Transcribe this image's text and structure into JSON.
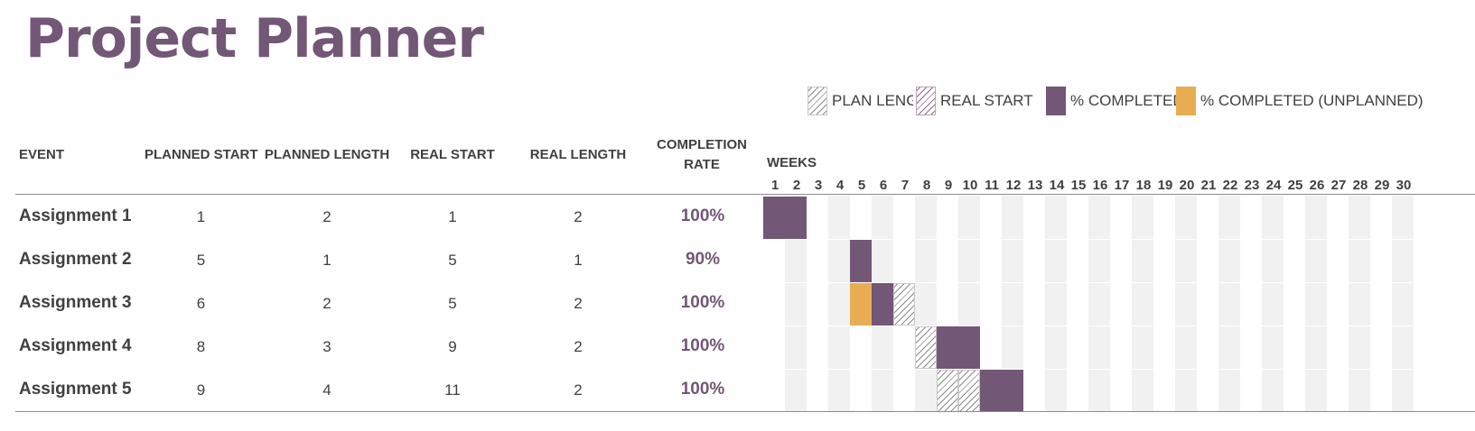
{
  "title": "Project Planner",
  "legend": {
    "plan_length": "PLAN LENGTH",
    "real_start": "REAL START",
    "completed": "% COMPLETED",
    "completed_unplanned": "% COMPLETED (UNPLANNED)"
  },
  "columns": {
    "event": "EVENT",
    "planned_start": "PLANNED START",
    "planned_length": "PLANNED LENGTH",
    "real_start": "REAL START",
    "real_length": "REAL LENGTH",
    "completion_rate": "COMPLETION RATE",
    "weeks": "WEEKS"
  },
  "weeks": [
    "1",
    "2",
    "3",
    "4",
    "5",
    "6",
    "7",
    "8",
    "9",
    "10",
    "11",
    "12",
    "13",
    "14",
    "15",
    "16",
    "17",
    "18",
    "19",
    "20",
    "21",
    "22",
    "23",
    "24",
    "25",
    "26",
    "27",
    "28",
    "29",
    "30"
  ],
  "rows": [
    {
      "event": "Assignment 1",
      "planned_start": "1",
      "planned_length": "2",
      "real_start": "1",
      "real_length": "2",
      "completion_rate": "100%"
    },
    {
      "event": "Assignment 2",
      "planned_start": "5",
      "planned_length": "1",
      "real_start": "5",
      "real_length": "1",
      "completion_rate": "90%"
    },
    {
      "event": "Assignment 3",
      "planned_start": "6",
      "planned_length": "2",
      "real_start": "5",
      "real_length": "2",
      "completion_rate": "100%"
    },
    {
      "event": "Assignment 4",
      "planned_start": "8",
      "planned_length": "3",
      "real_start": "9",
      "real_length": "2",
      "completion_rate": "100%"
    },
    {
      "event": "Assignment 5",
      "planned_start": "9",
      "planned_length": "4",
      "real_start": "11",
      "real_length": "2",
      "completion_rate": "100%"
    }
  ],
  "gantt": [
    [
      {
        "week": 1,
        "type": "completed"
      },
      {
        "week": 2,
        "type": "completed"
      }
    ],
    [
      {
        "week": 5,
        "type": "completed"
      }
    ],
    [
      {
        "week": 5,
        "type": "unplanned"
      },
      {
        "week": 6,
        "type": "completed"
      },
      {
        "week": 7,
        "type": "plan"
      }
    ],
    [
      {
        "week": 8,
        "type": "plan"
      },
      {
        "week": 9,
        "type": "completed"
      },
      {
        "week": 10,
        "type": "completed"
      }
    ],
    [
      {
        "week": 9,
        "type": "plan"
      },
      {
        "week": 10,
        "type": "plan"
      },
      {
        "week": 11,
        "type": "completed"
      },
      {
        "week": 12,
        "type": "completed"
      }
    ]
  ],
  "colors": {
    "accent": "#735776",
    "unplanned": "#e8ad52",
    "band": "#f1f1f1",
    "text": "#404040"
  }
}
